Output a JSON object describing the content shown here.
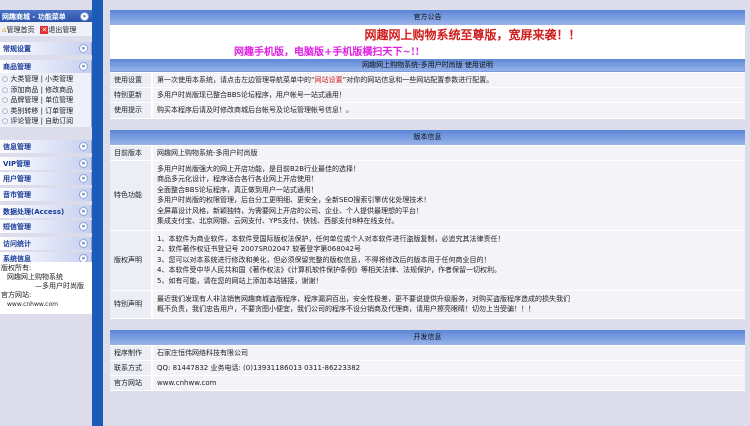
{
  "sidebar": {
    "title": "网趣商城 - 功能菜单",
    "home": "管理首页",
    "logout": "退出管理",
    "sections": [
      "常规设置",
      "商品管理",
      "信息管理",
      "VIP管理",
      "用户管理",
      "音市管理",
      "数据处理(Access)",
      "短信管理",
      "访问统计",
      "系统信息"
    ],
    "goods_items": [
      [
        "大类管理",
        "小类管理"
      ],
      [
        "添加商品",
        "修改商品"
      ],
      [
        "品牌管理",
        "单位管理"
      ],
      [
        "类别转移",
        "订单管理"
      ],
      [
        "评论管理",
        "自助订阅"
      ]
    ],
    "footer": {
      "l1": "版权所有:",
      "l2": "网趣网上购物系统",
      "l3": "—多用户时尚版",
      "l4": "官方网站:",
      "l5": "www.cnhww.com"
    }
  },
  "notice": {
    "header": "官方公告",
    "banner1": "网趣网上购物系统至尊版，宽屏来袭！！",
    "banner2": "网趣手机版，电脑版+手机版横扫天下~!!",
    "subheader": "网趣网上购物系统-多用户时尚版 使用说明",
    "rows": [
      {
        "label": "使用设置",
        "pre": "第一次使用本系统，请点击左边管理导航菜单中的“",
        "link": "网站设置",
        "post": "”对你的网站信息和一些网站配置参数进行配置。"
      },
      {
        "label": "特别更新",
        "text": "多用户时尚版现已整合BBS论坛程序，用户帐号一站式通用！"
      },
      {
        "label": "使用提示",
        "text": "购买本程序后请及时修改商城后台帐号及论坛管理帐号信息！。"
      }
    ]
  },
  "version": {
    "header": "版本信息",
    "current_label": "目前版本",
    "current": "网趣网上购物系统-多用户时尚版",
    "features_label": "特色功能",
    "features": [
      "多用户时尚版强大的网上开店功能，是目前B2B行业最佳的选择！",
      "商品多元化设计，程序适合各行各业网上开店使用！",
      "全面整合BBS论坛程序，真正做到用户一站式通用！",
      "多用户时尚版的权限管理，后台分工更明细、更安全，全新SEO搜索引擎优化处理技术！",
      "全屏幕设计风格，新颖独特，为需要网上开店的公司、企业、个人提供最理想的平台！",
      "集成支付宝、北京网银、云网支付、YPS支付、快钱、西部支付8种在线支付。"
    ],
    "copyright_label": "版权声明",
    "copyright": [
      "1、本软件为商业软件，本软件受国际版权法保护，任何单位或个人对本软件进行盗版复制，必追究其法律责任！",
      "2、软件著作权证书登记号 2007SR02047 软著登字第068042号",
      "3、您可以对本系统进行修改和美化，但必须保留完整的版权信息，不得将修改后的版本用于任何商业目的！",
      "4、本软件受中华人民共和国《著作权法》《计算机软件保护条例》等相关法律、法规保护，作者保留一切权利。",
      "5、如有可能，请在您的网站上添加本站链接，谢谢！"
    ],
    "special_label": "特别声明",
    "special": [
      "最近我们发现有人非法销售网趣商城盗版程序，程序漏洞百出，安全性极差，更不要说提供升级服务，对购买盗版程序造成的损失我们",
      "概不负责，我们忠告用户，不要贪图小便宜，我们公司的程序不设分销商及代理商，请用户擦亮眼睛！切勿上当受骗！！！"
    ]
  },
  "dev": {
    "header": "开发信息",
    "rows": [
      {
        "label": "程序制作",
        "text": "石家庄恒伟网络科技有限公司"
      },
      {
        "label": "联系方式",
        "text": "QQ: 81447832  业务电话: (0)13931186013  0311-86223382"
      },
      {
        "label": "官方网站",
        "text": "www.cnhww.com"
      }
    ]
  },
  "colors": {
    "accent": "#1a5cb8",
    "red": "#d02020",
    "magenta": "#e020e0"
  }
}
